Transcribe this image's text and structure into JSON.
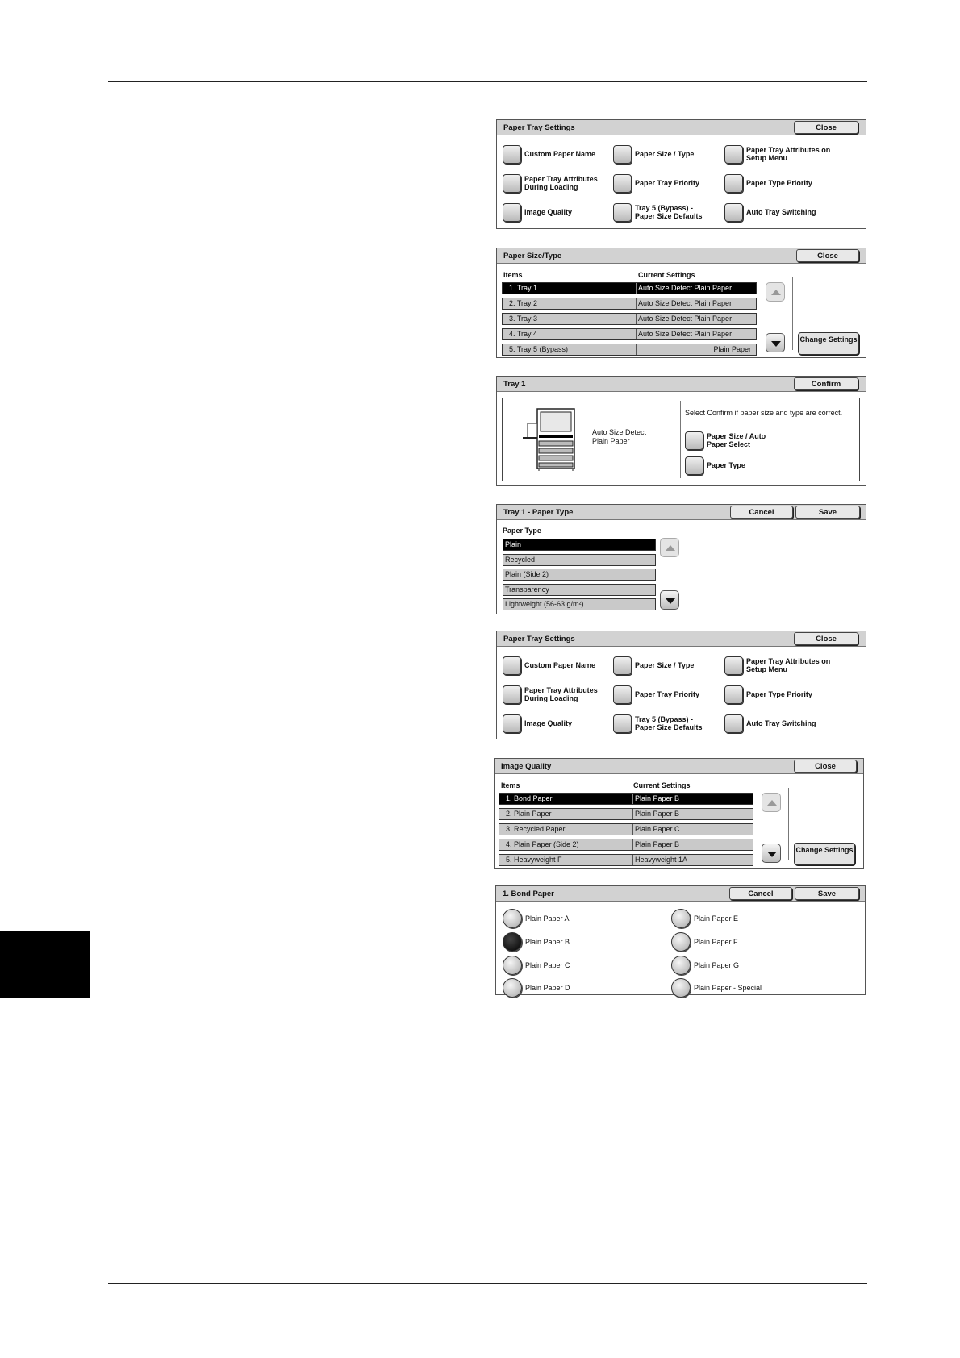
{
  "panels": {
    "paper_tray_settings": {
      "title": "Paper Tray Settings",
      "close": "Close",
      "buttons": {
        "custom_paper_name": "Custom Paper Name",
        "paper_size_type": "Paper Size / Type",
        "attributes_setup_menu": "Paper Tray Attributes on Setup Menu",
        "attributes_during_loading": "Paper Tray Attributes During Loading",
        "tray_priority": "Paper Tray Priority",
        "type_priority": "Paper Type Priority",
        "image_quality": "Image Quality",
        "tray5_defaults": "Tray 5 (Bypass) - Paper Size Defaults",
        "auto_tray_switching": "Auto Tray Switching"
      }
    },
    "paper_size_type": {
      "title": "Paper Size/Type",
      "close": "Close",
      "col_items": "Items",
      "col_current": "Current Settings",
      "rows": [
        {
          "item": "1. Tray 1",
          "value": "Auto Size Detect  Plain Paper"
        },
        {
          "item": "2. Tray 2",
          "value": "Auto Size Detect  Plain Paper"
        },
        {
          "item": "3. Tray 3",
          "value": "Auto Size Detect  Plain Paper"
        },
        {
          "item": "4. Tray 4",
          "value": "Auto Size Detect  Plain Paper"
        },
        {
          "item": "5. Tray 5 (Bypass)",
          "value": "Plain Paper"
        }
      ],
      "change_settings": "Change Settings"
    },
    "tray1": {
      "title": "Tray 1",
      "confirm": "Confirm",
      "status_line1": "Auto Size Detect",
      "status_line2": "Plain Paper",
      "instruction": "Select Confirm if paper size and type are correct.",
      "paper_size_button": "Paper Size / Auto Paper Select",
      "paper_type_button": "Paper Type"
    },
    "tray1_paper_type": {
      "title": "Tray 1 - Paper Type",
      "cancel": "Cancel",
      "save": "Save",
      "label": "Paper Type",
      "options": [
        "Plain",
        "Recycled",
        "Plain (Side 2)",
        "Transparency",
        "Lightweight (56-63 g/m²)"
      ]
    },
    "paper_tray_settings_2": {
      "title": "Paper Tray Settings",
      "close": "Close"
    },
    "image_quality": {
      "title": "Image Quality",
      "close": "Close",
      "col_items": "Items",
      "col_current": "Current Settings",
      "rows": [
        {
          "item": "1. Bond Paper",
          "value": "Plain Paper B"
        },
        {
          "item": "2. Plain Paper",
          "value": "Plain Paper B"
        },
        {
          "item": "3. Recycled Paper",
          "value": "Plain Paper C"
        },
        {
          "item": "4. Plain Paper (Side 2)",
          "value": "Plain Paper B"
        },
        {
          "item": "5. Heavyweight F",
          "value": "Heavyweight 1A"
        }
      ],
      "change_settings": "Change Settings"
    },
    "bond_paper": {
      "title": "1. Bond Paper",
      "cancel": "Cancel",
      "save": "Save",
      "options_left": [
        "Plain Paper A",
        "Plain Paper B",
        "Plain Paper C",
        "Plain Paper D"
      ],
      "options_right": [
        "Plain Paper E",
        "Plain Paper F",
        "Plain Paper G",
        "Plain Paper - Special"
      ],
      "selected": "Plain Paper B"
    }
  }
}
